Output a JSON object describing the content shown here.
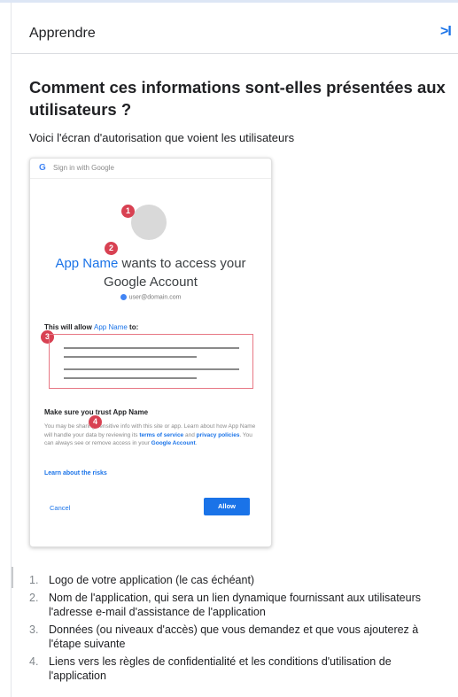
{
  "header": {
    "title": "Apprendre",
    "collapse_label": ">I"
  },
  "section": {
    "title": "Comment ces informations sont-elles présentées aux utilisateurs ?",
    "intro": "Voici l'écran d'autorisation que voient les utilisateurs"
  },
  "consent_mock": {
    "signin_label": "Sign in with Google",
    "google_glyph": "G",
    "title_app": "App Name",
    "title_rest": " wants to access your",
    "title_line2": "Google Account",
    "account_email": "user@domain.com",
    "allow_intro": "This will allow ",
    "allow_app": "App Name",
    "allow_suffix": " to:",
    "trust_heading": "Make sure you trust App Name",
    "trust_text_1": "You may be sharing sensitive info with this site or app. Learn about how App Name will handle your data by reviewing its ",
    "terms_link": "terms of service",
    "and_text": " and ",
    "privacy_link": "privacy policies",
    "trust_text_2": ". You can always see or remove access in your ",
    "google_account_link": "Google Account",
    "trust_text_3": ".",
    "learn_risks": "Learn about the risks",
    "cancel_label": "Cancel",
    "allow_label": "Allow",
    "badges": [
      "1",
      "2",
      "3",
      "4"
    ]
  },
  "steps": [
    {
      "num": "1.",
      "text": "Logo de votre application (le cas échéant)"
    },
    {
      "num": "2.",
      "text": "Nom de l'application, qui sera un lien dynamique fournissant aux utilisateurs l'adresse e-mail d'assistance de l'application"
    },
    {
      "num": "3.",
      "text": "Données (ou niveaux d'accès) que vous demandez et que vous ajouterez à l'étape suivante"
    },
    {
      "num": "4.",
      "text": "Liens vers les règles de confidentialité et les conditions d'utilisation de l'application"
    }
  ],
  "colors": {
    "accent": "#1a73e8",
    "badge": "#d84152",
    "highlight_border": "#e77784"
  }
}
